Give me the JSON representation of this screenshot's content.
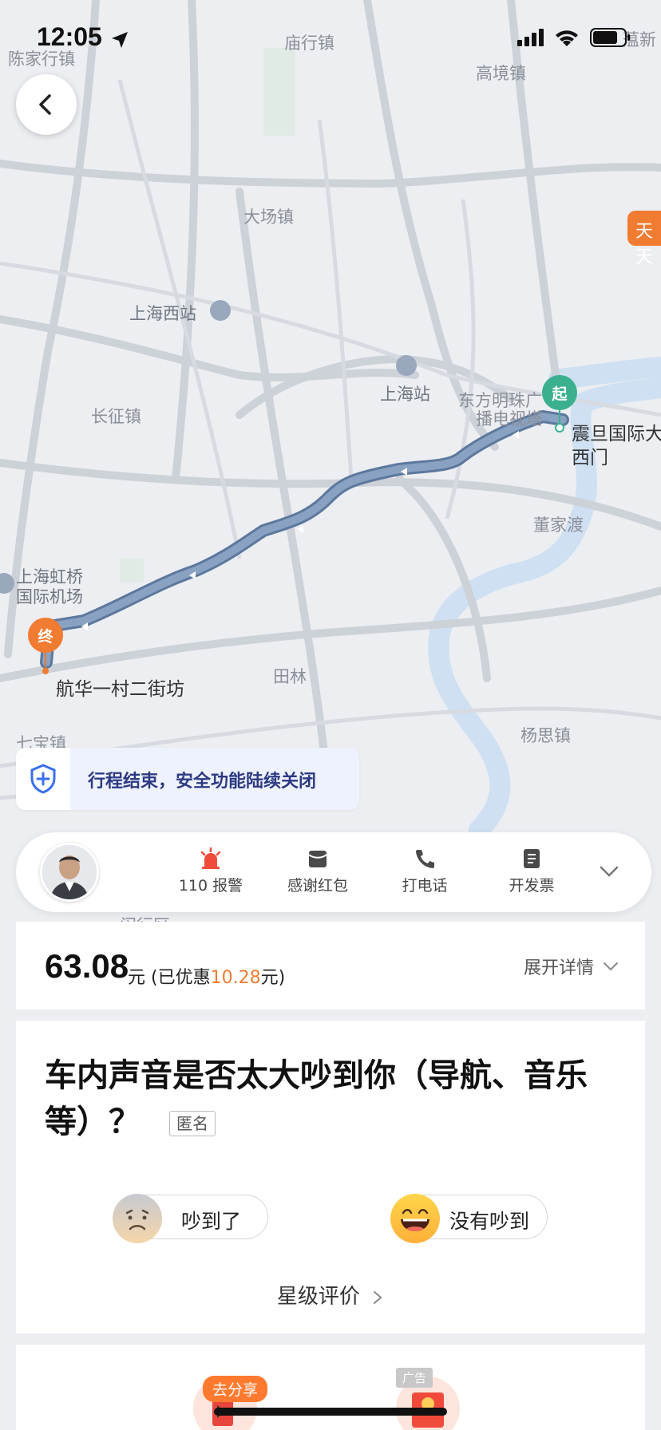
{
  "status_bar": {
    "time": "12:05"
  },
  "map": {
    "labels": {
      "chenjia": "陈家行镇",
      "miaohang": "庙行镇",
      "gaojing": "高境镇",
      "dachang": "大场镇",
      "shanghai_west": "上海西站",
      "shanghai_station": "上海站",
      "changzheng": "长征镇",
      "oriental_pearl_1": "东方明珠广",
      "oriental_pearl_2": "播电视塔",
      "fudan_1": "震旦国际大",
      "fudan_2": "西门",
      "dongjiadu": "董家渡",
      "hongqiao_1": "上海虹桥",
      "hongqiao_2": "国际机场",
      "dest_name": "航华一村二街坊",
      "tianlin": "田林",
      "qibao": "七宝镇",
      "yangsi": "杨思镇",
      "top_right": "蕰新",
      "top_right_badge": "天天",
      "minhang_partial": "闵行区"
    },
    "start_pin": "起",
    "end_pin": "终"
  },
  "safety_banner": {
    "text": "行程结束，安全功能陆续关闭"
  },
  "driver_bar": {
    "actions": [
      {
        "label": "110 报警"
      },
      {
        "label": "感谢红包"
      },
      {
        "label": "打电话"
      },
      {
        "label": "开发票"
      }
    ]
  },
  "price": {
    "amount": "63.08",
    "unit_prefix": "元 (已优惠",
    "discount": "10.28",
    "unit_suffix": "元)",
    "expand_label": "展开详情"
  },
  "survey": {
    "question": "车内声音是否太大吵到你（导航、音乐等）？",
    "anonymous_tag": "匿名",
    "option_noisy": "吵到了",
    "option_quiet": "没有吵到",
    "star_rating_link": "星级评价"
  },
  "bottom": {
    "share_badge": "去分享",
    "ad_tag": "广告"
  },
  "colors": {
    "route": "#7c95b6",
    "accent_orange": "#f07c32",
    "start_green": "#3bb08f"
  }
}
